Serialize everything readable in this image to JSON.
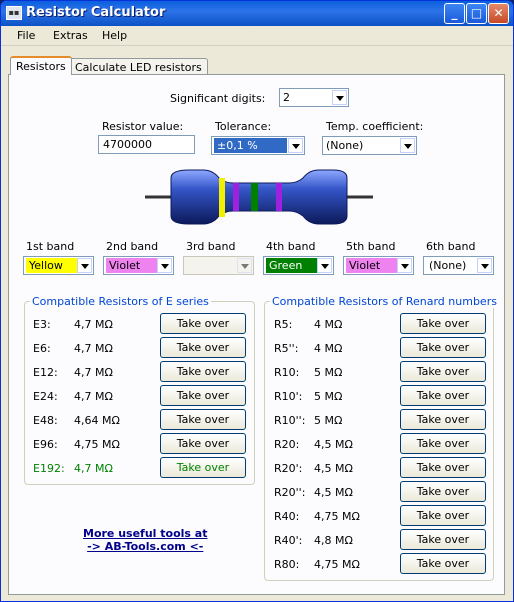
{
  "window": {
    "title": "Resistor Calculator"
  },
  "menu": [
    "File",
    "Extras",
    "Help"
  ],
  "tabs": [
    "Resistors",
    "Calculate LED resistors"
  ],
  "sig": {
    "label": "Significant digits:",
    "value": "2"
  },
  "resval": {
    "label": "Resistor value:",
    "value": "4700000"
  },
  "tol": {
    "label": "Tolerance:",
    "value": "±0,1 %"
  },
  "temp": {
    "label": "Temp. coefficient:",
    "value": "(None)"
  },
  "bands": [
    {
      "label": "1st band",
      "value": "Yellow",
      "color": "#ffff00",
      "text": "#000"
    },
    {
      "label": "2nd band",
      "value": "Violet",
      "color": "#ee82ee",
      "text": "#000"
    },
    {
      "label": "3rd band",
      "value": "",
      "color": "#ffffff",
      "text": "#000"
    },
    {
      "label": "4th band",
      "value": "Green",
      "color": "#008000",
      "text": "#fff"
    },
    {
      "label": "5th band",
      "value": "Violet",
      "color": "#ee82ee",
      "text": "#000"
    },
    {
      "label": "6th band",
      "value": "(None)",
      "color": "#ffffff",
      "text": "#000"
    }
  ],
  "eseries": {
    "title": "Compatible Resistors of E series",
    "button": "Take over",
    "rows": [
      [
        "E3:",
        "4,7 MΩ"
      ],
      [
        "E6:",
        "4,7 MΩ"
      ],
      [
        "E12:",
        "4,7 MΩ"
      ],
      [
        "E24:",
        "4,7 MΩ"
      ],
      [
        "E48:",
        "4,64 MΩ"
      ],
      [
        "E96:",
        "4,75 MΩ"
      ],
      [
        "E192:",
        "4,7 MΩ"
      ]
    ],
    "highlight_color": "#008000"
  },
  "renard": {
    "title": "Compatible Resistors of Renard numbers",
    "button": "Take over",
    "rows": [
      [
        "R5:",
        "4 MΩ"
      ],
      [
        "R5'':",
        "4 MΩ"
      ],
      [
        "R10:",
        "5 MΩ"
      ],
      [
        "R10':",
        "5 MΩ"
      ],
      [
        "R10'':",
        "5 MΩ"
      ],
      [
        "R20:",
        "4,5 MΩ"
      ],
      [
        "R20':",
        "4,5 MΩ"
      ],
      [
        "R20'':",
        "4,5 MΩ"
      ],
      [
        "R40:",
        "4,75 MΩ"
      ],
      [
        "R40':",
        "4,8 MΩ"
      ],
      [
        "R80:",
        "4,75 MΩ"
      ]
    ]
  },
  "link": {
    "line1": "More useful tools at",
    "line2": "-> AB-Tools.com <-"
  }
}
